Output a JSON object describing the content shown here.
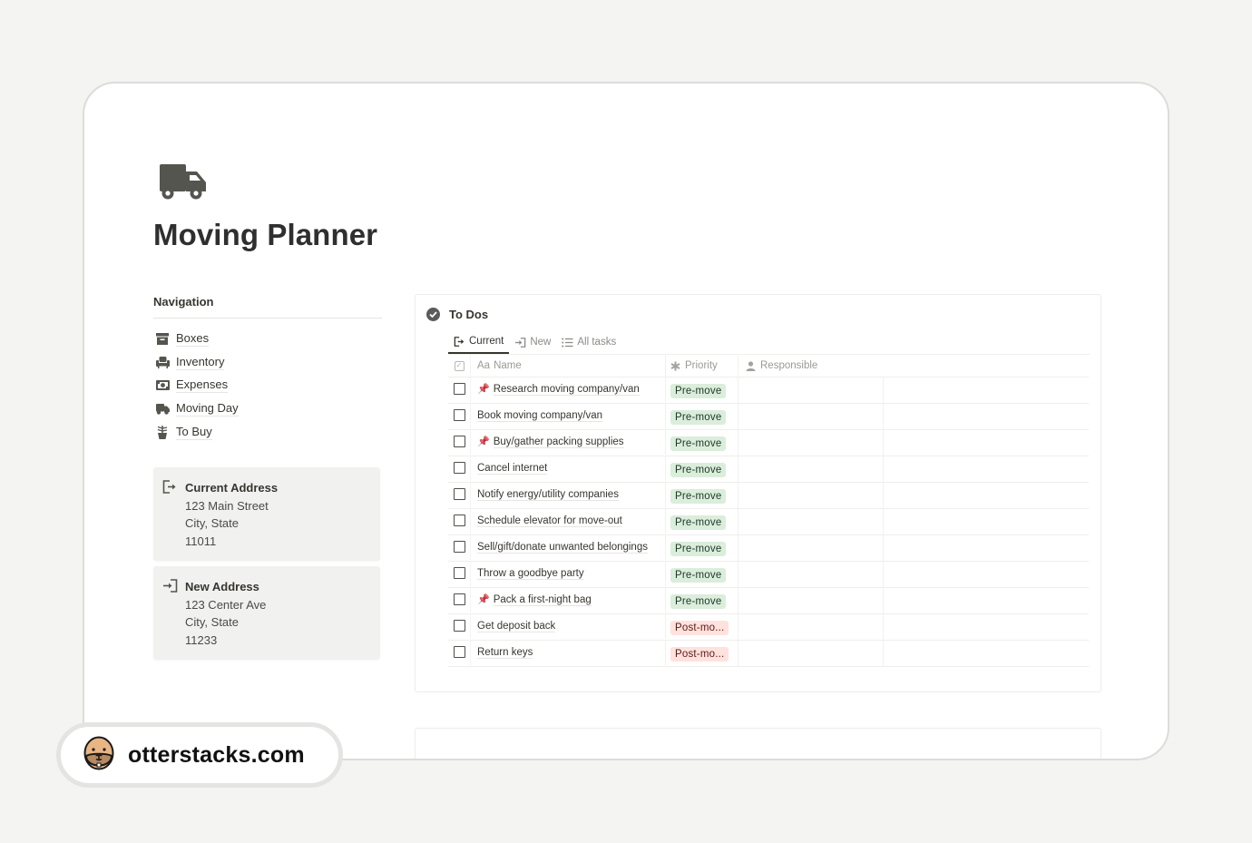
{
  "page": {
    "icon": "truck-icon",
    "title": "Moving Planner"
  },
  "navigation": {
    "heading": "Navigation",
    "items": [
      {
        "label": "Boxes",
        "icon": "archive-box-icon"
      },
      {
        "label": "Inventory",
        "icon": "armchair-icon"
      },
      {
        "label": "Expenses",
        "icon": "money-bill-icon"
      },
      {
        "label": "Moving Day",
        "icon": "truck-icon"
      },
      {
        "label": "To Buy",
        "icon": "plant-pot-icon"
      }
    ]
  },
  "addresses": {
    "current": {
      "icon": "exit-door-icon",
      "title": "Current Address",
      "line1": "123 Main Street",
      "line2": "City, State",
      "line3": "11011"
    },
    "new": {
      "icon": "enter-door-icon",
      "title": "New Address",
      "line1": "123 Center Ave",
      "line2": "City, State",
      "line3": "11233"
    }
  },
  "todos": {
    "title": "To Dos",
    "tabs": [
      {
        "label": "Current",
        "icon": "exit-door-icon",
        "active": true
      },
      {
        "label": "New",
        "icon": "enter-door-icon",
        "active": false
      },
      {
        "label": "All tasks",
        "icon": "list-icon",
        "active": false
      }
    ],
    "columns": {
      "name": "Name",
      "name_prefix": "Aa",
      "priority": "Priority",
      "responsible": "Responsible"
    },
    "rows": [
      {
        "name": "Research moving company/van",
        "pinned": true,
        "priority": "Pre-move",
        "priority_type": "pre",
        "checked": false
      },
      {
        "name": "Book moving company/van",
        "pinned": false,
        "priority": "Pre-move",
        "priority_type": "pre",
        "checked": false
      },
      {
        "name": "Buy/gather packing supplies",
        "pinned": true,
        "priority": "Pre-move",
        "priority_type": "pre",
        "checked": false
      },
      {
        "name": "Cancel internet",
        "pinned": false,
        "priority": "Pre-move",
        "priority_type": "pre",
        "checked": false
      },
      {
        "name": "Notify energy/utility companies",
        "pinned": false,
        "priority": "Pre-move",
        "priority_type": "pre",
        "checked": false
      },
      {
        "name": "Schedule elevator for move-out",
        "pinned": false,
        "priority": "Pre-move",
        "priority_type": "pre",
        "checked": false
      },
      {
        "name": "Sell/gift/donate unwanted belongings",
        "pinned": false,
        "priority": "Pre-move",
        "priority_type": "pre",
        "checked": false
      },
      {
        "name": "Throw a goodbye party",
        "pinned": false,
        "priority": "Pre-move",
        "priority_type": "pre",
        "checked": false
      },
      {
        "name": "Pack a first-night bag",
        "pinned": true,
        "priority": "Pre-move",
        "priority_type": "pre",
        "checked": false
      },
      {
        "name": "Get deposit back",
        "pinned": false,
        "priority": "Post-mo...",
        "priority_type": "post",
        "checked": false
      },
      {
        "name": "Return keys",
        "pinned": false,
        "priority": "Post-mo...",
        "priority_type": "post",
        "checked": false
      }
    ]
  },
  "colors": {
    "pre_bg": "#dbeddb",
    "pre_text": "#1c3829",
    "post_bg": "#ffe2dd",
    "post_text": "#5d1715",
    "pin": "#b03a4e"
  },
  "brand": {
    "logo": "otter-face-icon",
    "text": "otterstacks.com"
  }
}
